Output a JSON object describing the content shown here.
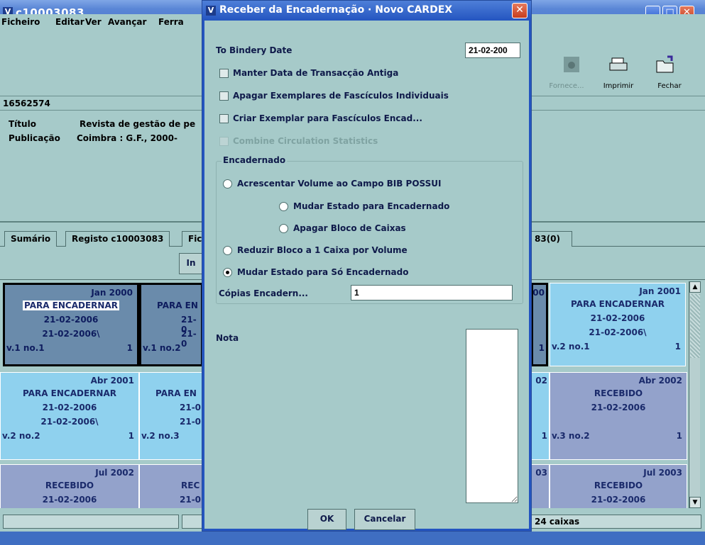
{
  "main_window": {
    "title": "c10003083",
    "menu": [
      "Ficheiro",
      "Editar",
      "Ver",
      "Avançar",
      "Ferra"
    ],
    "toolbar": {
      "fornece_label": "Fornece...",
      "imprimir_label": "Imprimir",
      "fechar_label": "Fechar"
    },
    "record_id": "16562574",
    "info": {
      "titulo_label": "Título",
      "titulo_value": "Revista de gestão de pe",
      "publicacao_label": "Publicação",
      "publicacao_value": "Coimbra : G.F., 2000-"
    },
    "tabs": [
      "Sumário",
      "Registo c10003083",
      "Fic",
      "83(0)"
    ],
    "subbar_button": "In",
    "status_text": "24 caixas"
  },
  "grid": {
    "cells": [
      {
        "date": "Jan 2000",
        "status": "PARA ENCADERNAR",
        "d1": "21-02-2006",
        "d2": "21-02-2006\\",
        "vol": "v.1 no.1",
        "count": "1"
      },
      {
        "date": "",
        "status": "PARA EN",
        "d1": "21-0",
        "d2": "21-0",
        "vol": "v.1 no.2",
        "count": ""
      },
      {
        "date": "00",
        "status": "",
        "d1": "",
        "d2": "",
        "vol": "",
        "count": "1"
      },
      {
        "date": "Jan 2001",
        "status": "PARA ENCADERNAR",
        "d1": "21-02-2006",
        "d2": "21-02-2006\\",
        "vol": "v.2 no.1",
        "count": "1"
      },
      {
        "date": "Abr 2001",
        "status": "PARA ENCADERNAR",
        "d1": "21-02-2006",
        "d2": "21-02-2006\\",
        "vol": "v.2 no.2",
        "count": "1"
      },
      {
        "date": "",
        "status": "PARA EN",
        "d1": "21-0",
        "d2": "21-0",
        "vol": "v.2 no.3",
        "count": ""
      },
      {
        "date": "02",
        "status": "",
        "d1": "",
        "d2": "",
        "vol": "",
        "count": "1"
      },
      {
        "date": "Abr 2002",
        "status": "RECEBIDO",
        "d1": "21-02-2006",
        "d2": "",
        "vol": "v.3 no.2",
        "count": "1"
      },
      {
        "date": "Jul 2002",
        "status": "RECEBIDO",
        "d1": "21-02-2006",
        "d2": "",
        "vol": "",
        "count": ""
      },
      {
        "date": "",
        "status": "REC",
        "d1": "21-0",
        "d2": "",
        "vol": "",
        "count": ""
      },
      {
        "date": "03",
        "status": "",
        "d1": "",
        "d2": "",
        "vol": "",
        "count": ""
      },
      {
        "date": "Jul 2003",
        "status": "RECEBIDO",
        "d1": "21-02-2006",
        "d2": "",
        "vol": "",
        "count": ""
      }
    ]
  },
  "dialog": {
    "title": "Receber da Encadernação · Novo CARDEX",
    "to_bindery_date_label": "To Bindery Date",
    "to_bindery_date_value": "21-02-200",
    "checkboxes": [
      {
        "label": "Manter Data de Transacção Antiga",
        "checked": false,
        "enabled": true
      },
      {
        "label": "Apagar Exemplares de Fascículos Individuais",
        "checked": false,
        "enabled": true
      },
      {
        "label": "Criar Exemplar para Fascículos Encad...",
        "checked": false,
        "enabled": true
      },
      {
        "label": "Combine Circulation Statistics",
        "checked": false,
        "enabled": false
      }
    ],
    "group_title": "Encadernado",
    "radios": [
      {
        "label": "Acrescentar Volume ao Campo BIB POSSUI",
        "selected": false
      },
      {
        "label": "Mudar Estado para Encadernado",
        "selected": false
      },
      {
        "label": "Apagar Bloco de Caixas",
        "selected": false
      },
      {
        "label": "Reduzir Bloco a 1 Caixa por Volume",
        "selected": false
      },
      {
        "label": "Mudar Estado para Só Encadernado",
        "selected": true
      }
    ],
    "copias_label": "Cópias Encadern...",
    "copias_value": "1",
    "nota_label": "Nota",
    "ok_label": "OK",
    "cancel_label": "Cancelar"
  }
}
